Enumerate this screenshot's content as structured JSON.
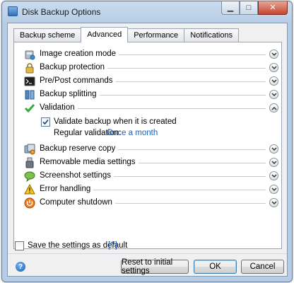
{
  "window": {
    "title": "Disk Backup Options",
    "controls": {
      "minimize": "▁",
      "maximize": "□",
      "close": "✕"
    }
  },
  "tabs": [
    {
      "label": "Backup scheme",
      "active": false
    },
    {
      "label": "Advanced",
      "active": true
    },
    {
      "label": "Performance",
      "active": false
    },
    {
      "label": "Notifications",
      "active": false
    }
  ],
  "sections": [
    {
      "label": "Image creation mode",
      "icon": "disk-image-icon",
      "expanded": false
    },
    {
      "label": "Backup protection",
      "icon": "lock-icon",
      "expanded": false
    },
    {
      "label": "Pre/Post commands",
      "icon": "terminal-icon",
      "expanded": false
    },
    {
      "label": "Backup splitting",
      "icon": "split-icon",
      "expanded": false
    },
    {
      "label": "Validation",
      "icon": "checkmark-icon",
      "expanded": true
    },
    {
      "label": "Backup reserve copy",
      "icon": "reserve-copy-icon",
      "expanded": false
    },
    {
      "label": "Removable media settings",
      "icon": "usb-icon",
      "expanded": false
    },
    {
      "label": "Screenshot settings",
      "icon": "speech-bubble-icon",
      "expanded": false
    },
    {
      "label": "Error handling",
      "icon": "warning-icon",
      "expanded": false
    },
    {
      "label": "Computer shutdown",
      "icon": "power-icon",
      "expanded": false
    }
  ],
  "validation": {
    "validate_label": "Validate backup when it is created",
    "validate_checked": true,
    "regular_label": "Regular validation:",
    "regular_value": "Once a month"
  },
  "footer": {
    "save_default_label": "Save the settings as default",
    "save_default_checked": false,
    "help_link": "[?]"
  },
  "buttons": {
    "reset": "Reset to initial settings",
    "ok": "OK",
    "cancel": "Cancel"
  },
  "colors": {
    "link": "#1e5fb3",
    "titlebar": "#b7cde6",
    "close_button": "#c5452e"
  }
}
